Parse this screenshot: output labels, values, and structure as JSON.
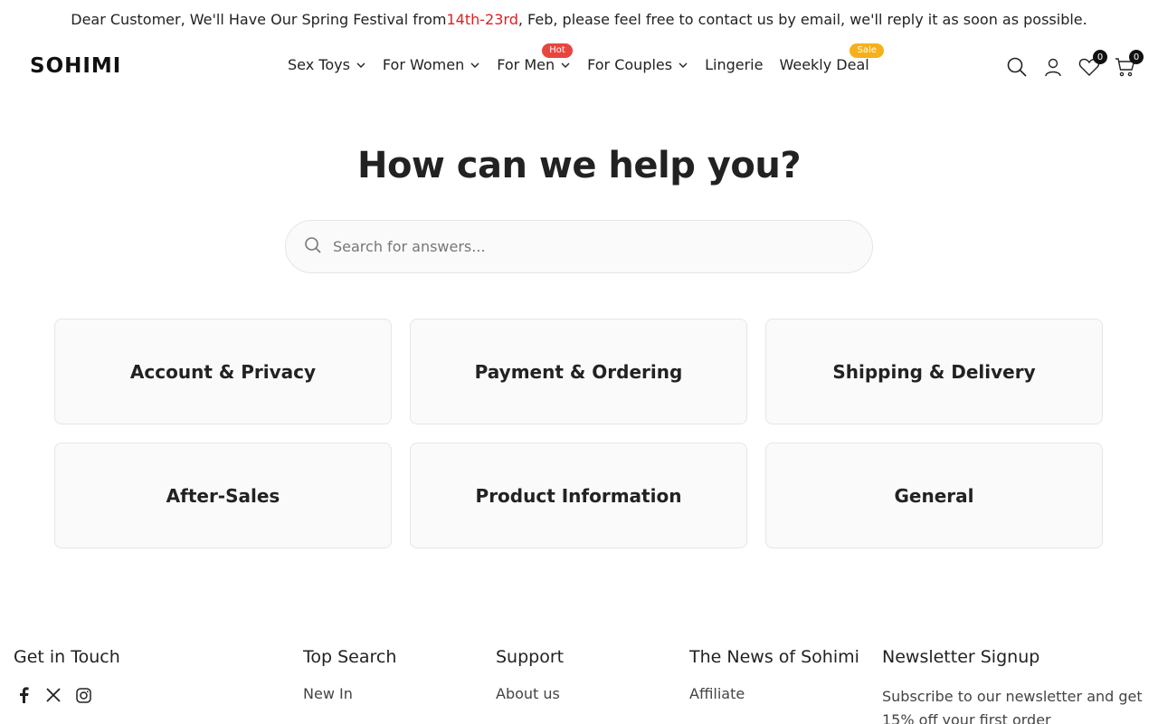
{
  "announcement": {
    "before": "Dear Customer, We'll Have Our Spring Festival from ",
    "highlight": "14th-23rd",
    "after": ", Feb, please feel free to contact us by email, we'll reply it as soon as possible."
  },
  "header": {
    "logo": "SOHIMI",
    "nav": [
      {
        "label": "Sex Toys"
      },
      {
        "label": "For Women"
      },
      {
        "label": "For Men",
        "badge": "Hot"
      },
      {
        "label": "For Couples"
      },
      {
        "label": "Lingerie"
      },
      {
        "label": "Weekly Deal",
        "badge": "Sale"
      }
    ],
    "icons": {
      "search": "search-icon",
      "account": "user-icon",
      "wishlist": "heart-icon",
      "wishlist_count": "0",
      "cart": "cart-icon",
      "cart_count": "0"
    }
  },
  "help": {
    "title": "How can we help you?",
    "search_placeholder": "Search for answers...",
    "categories": [
      "Account & Privacy",
      "Payment & Ordering",
      "Shipping & Delivery",
      "After-Sales",
      "Product Information",
      "General"
    ]
  },
  "footer": {
    "get_in_touch": {
      "title": "Get in Touch",
      "social": [
        "facebook-icon",
        "x-icon",
        "instagram-icon"
      ]
    },
    "top_search": {
      "title": "Top Search",
      "links": [
        "New In"
      ]
    },
    "support": {
      "title": "Support",
      "links": [
        "About us"
      ]
    },
    "news": {
      "title": "The News of Sohimi",
      "links": [
        "Affiliate"
      ]
    },
    "newsletter": {
      "title": "Newsletter Signup",
      "text": "Subscribe to our newsletter and get 15% off your first order"
    }
  },
  "colors": {
    "highlight": "#e02020",
    "hot_badge": "#e9453f",
    "sale_badge": "#f6b01a"
  }
}
